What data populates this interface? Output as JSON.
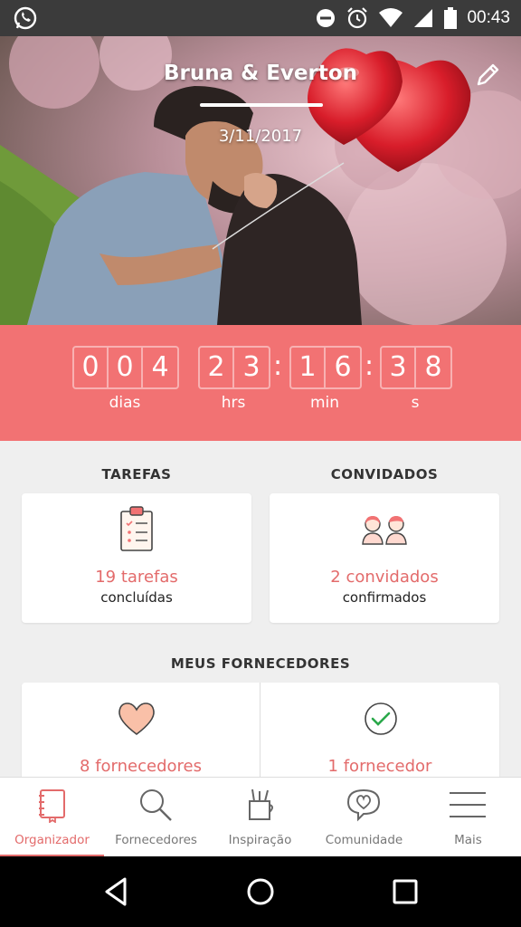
{
  "status_bar": {
    "time": "00:43",
    "left_icon": "whatsapp-icon",
    "right_icons": [
      "do-not-disturb-icon",
      "alarm-icon",
      "wifi-icon",
      "signal-icon",
      "battery-icon"
    ]
  },
  "hero": {
    "couple_name": "Bruna & Everton",
    "wedding_date": "3/11/2017",
    "edit_icon": "pencil-icon"
  },
  "countdown": {
    "days": [
      "0",
      "0",
      "4"
    ],
    "hours": [
      "2",
      "3"
    ],
    "minutes": [
      "1",
      "6"
    ],
    "seconds": [
      "3",
      "8"
    ],
    "separator": ":",
    "labels": {
      "days": "dias",
      "hours": "hrs",
      "minutes": "min",
      "seconds": "s"
    }
  },
  "tasks": {
    "title": "TAREFAS",
    "count": "19 tarefas",
    "sub": "concluídas",
    "icon": "clipboard-checklist-icon"
  },
  "guests": {
    "title": "CONVIDADOS",
    "count": "2 convidados",
    "sub": "confirmados",
    "icon": "couple-guests-icon"
  },
  "vendors": {
    "title": "MEUS FORNECEDORES",
    "items": [
      {
        "count": "8 fornecedores",
        "icon": "heart-icon"
      },
      {
        "count": "1 fornecedor",
        "icon": "check-circle-icon"
      }
    ]
  },
  "bottom_nav": {
    "items": [
      {
        "label": "Organizador",
        "icon": "notebook-icon",
        "active": true
      },
      {
        "label": "Fornecedores",
        "icon": "magnifier-icon",
        "active": false
      },
      {
        "label": "Inspiração",
        "icon": "pencil-cup-icon",
        "active": false
      },
      {
        "label": "Comunidade",
        "icon": "speech-heart-icon",
        "active": false
      },
      {
        "label": "Mais",
        "icon": "menu-icon",
        "active": false
      }
    ]
  },
  "colors": {
    "accent": "#f27273",
    "accent_text": "#e36b6b",
    "status_bar": "#3b3b3b",
    "background": "#efefef"
  }
}
